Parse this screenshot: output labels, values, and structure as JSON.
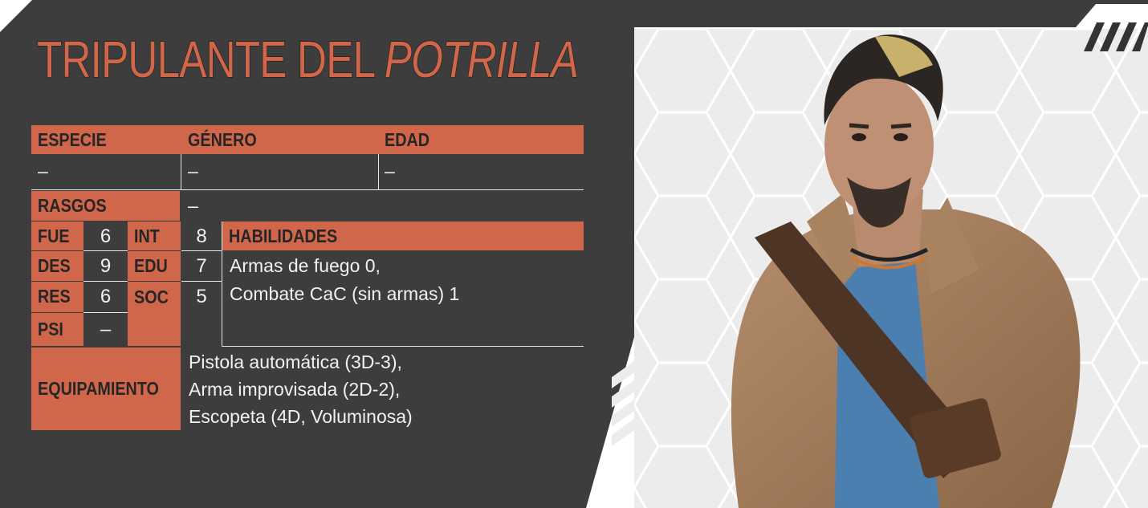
{
  "title": {
    "main": "TRIPULANTE DEL ",
    "emph": "POTRILLA"
  },
  "labels": {
    "especie": "ESPECIE",
    "genero": "GÉNERO",
    "edad": "EDAD",
    "rasgos": "RASGOS",
    "habilidades": "HABILIDADES",
    "equipamiento": "EQUIPAMIENTO"
  },
  "values": {
    "especie": "–",
    "genero": "–",
    "edad": "–",
    "rasgos": "–"
  },
  "stats": {
    "fue": {
      "label": "FUE",
      "value": "6"
    },
    "des": {
      "label": "DES",
      "value": "9"
    },
    "res": {
      "label": "RES",
      "value": "6"
    },
    "psi": {
      "label": "PSI",
      "value": "–"
    },
    "int": {
      "label": "INT",
      "value": "8"
    },
    "edu": {
      "label": "EDU",
      "value": "7"
    },
    "soc": {
      "label": "SOC",
      "value": "5"
    }
  },
  "habilidades": [
    "Armas de fuego 0,",
    "Combate CaC (sin armas) 1"
  ],
  "equipamiento": [
    "Pistola automática (3D-3),",
    "Arma improvisada (2D-2),",
    "Escopeta (4D, Voluminosa)"
  ],
  "colors": {
    "panel": "#3d3d3d",
    "accent": "#d0674a",
    "text": "#f1f1f1",
    "photo_bg": "#ececec"
  }
}
